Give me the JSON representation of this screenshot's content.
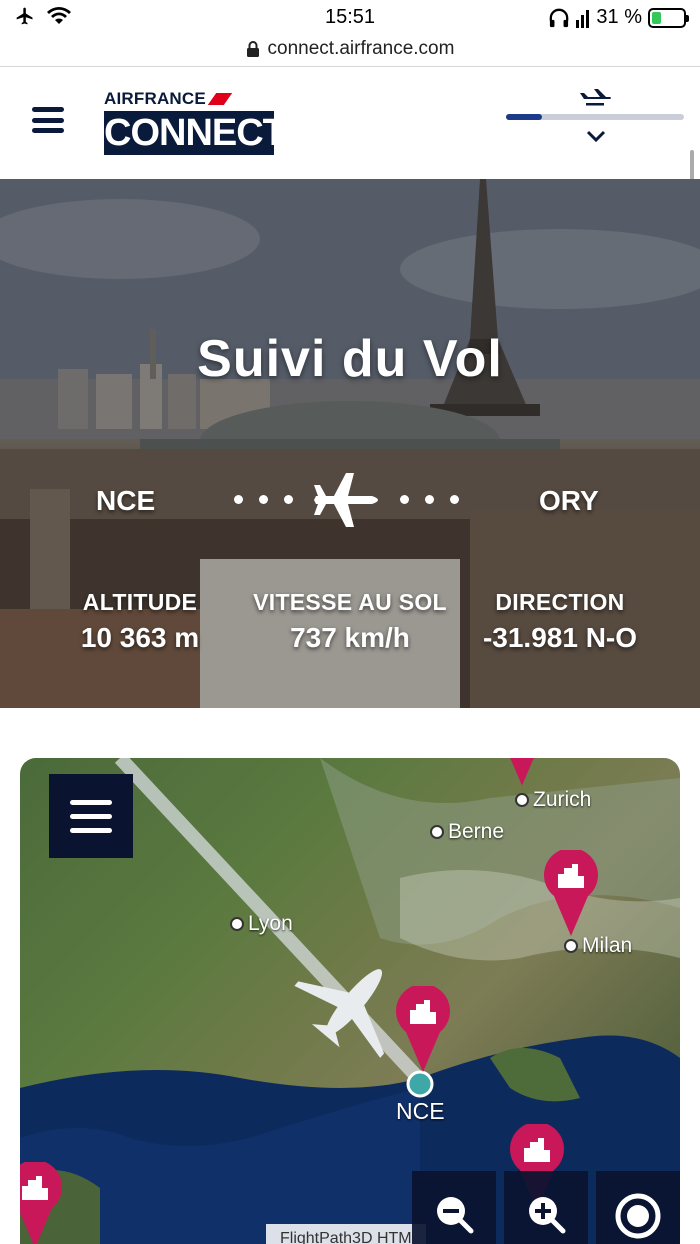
{
  "status_bar": {
    "time": "15:51",
    "battery_text": "31 %",
    "battery_level": 0.31,
    "icons": [
      "airplane-mode-icon",
      "wifi-icon",
      "headphones-icon",
      "signal-icon",
      "battery-charging-icon"
    ]
  },
  "browser": {
    "url": "connect.airfrance.com",
    "lock_icon": "lock-icon"
  },
  "header": {
    "menu_icon": "hamburger-menu-icon",
    "logo_top": "AIRFRANCE",
    "logo_bottom": "CONNECT",
    "flight_progress": 0.2,
    "flight_icon": "airplane-landing-icon",
    "toggle_icon": "chevron-down-icon"
  },
  "hero": {
    "title": "Suivi du Vol",
    "origin": "NCE",
    "destination": "ORY",
    "stats": [
      {
        "label": "ALTITUDE",
        "value": "10 363 m"
      },
      {
        "label": "VITESSE AU SOL",
        "value": "737 km/h"
      },
      {
        "label": "DIRECTION",
        "value": "-31.981 N-O"
      }
    ]
  },
  "map": {
    "cities": [
      "Zurich",
      "Berne",
      "Lyon",
      "Milan"
    ],
    "airport": "NCE",
    "attribution": "FlightPath3D HTM",
    "controls": [
      "zoom-out-icon",
      "zoom-in-icon",
      "recenter-icon"
    ],
    "poi_icon": "city-pin-icon",
    "colors": {
      "pin": "#c8185a",
      "airport_dot": "#3ea7a7",
      "menu_bg": "#0a1430"
    }
  }
}
